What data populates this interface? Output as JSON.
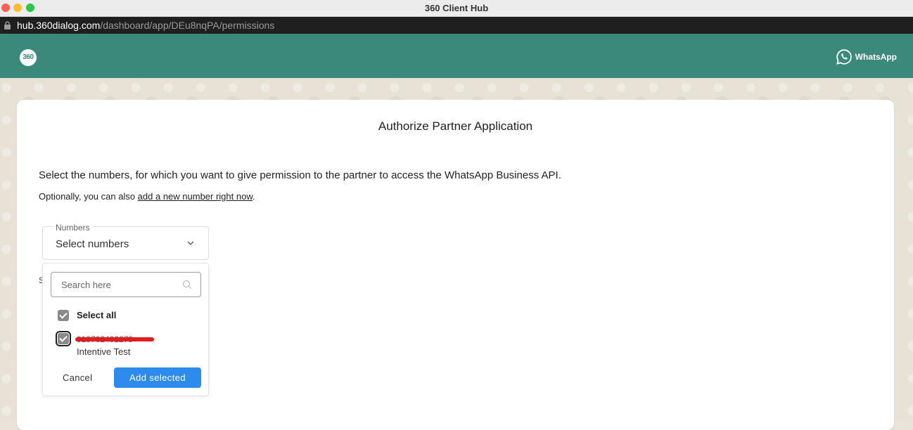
{
  "window": {
    "title": "360 Client Hub"
  },
  "browser": {
    "url_host": "hub.360dialog.com",
    "url_path": "/dashboard/app/DEu8nqPA/permissions"
  },
  "header": {
    "logo_text": "360",
    "whatsapp_label": "WhatsApp"
  },
  "page": {
    "title": "Authorize Partner Application",
    "description": "Select the numbers, for which you want to give permission to the partner to access the WhatsApp Business API.",
    "optional_prefix": "Optionally, you can also ",
    "optional_link": "add a new number right now",
    "optional_suffix": ".",
    "hidden_label_fragment": "S"
  },
  "numbers_select": {
    "legend": "Numbers",
    "value": "Select numbers"
  },
  "dropdown": {
    "search_placeholder": "Search here",
    "select_all_label": "Select all",
    "select_all_checked": true,
    "items": [
      {
        "phone": "919702492279",
        "name": "Intentive Test",
        "checked": true
      }
    ],
    "cancel_label": "Cancel",
    "add_label": "Add selected"
  },
  "colors": {
    "header": "#3b897b",
    "primary": "#2d8bee",
    "redaction": "#e31b23"
  }
}
